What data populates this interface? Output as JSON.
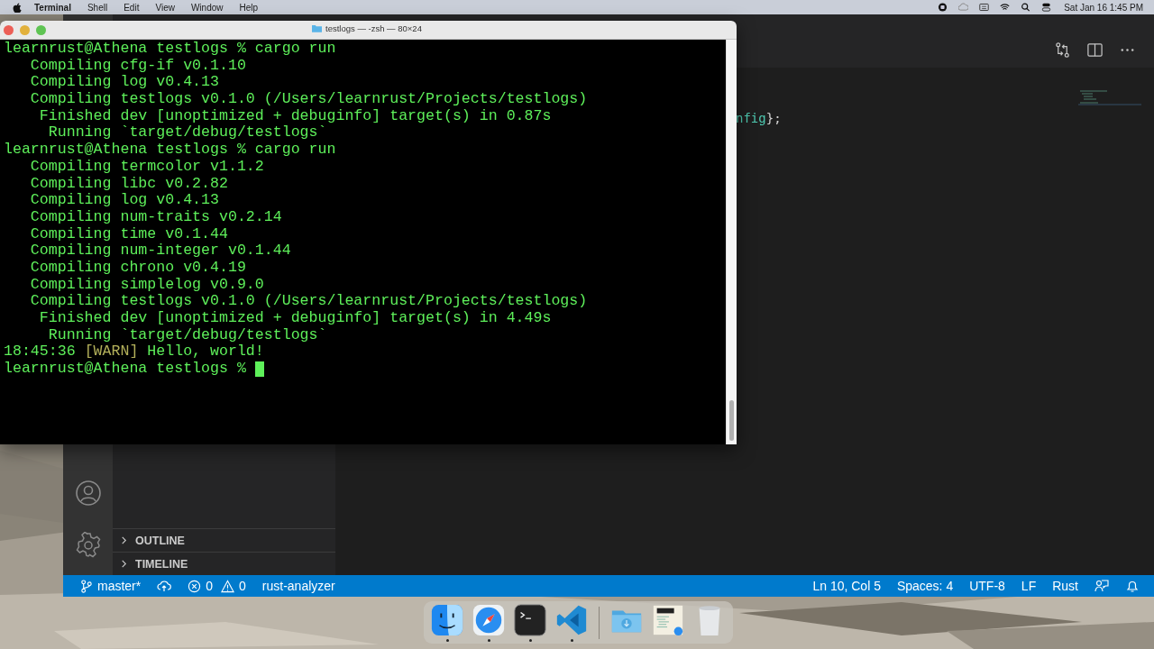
{
  "menubar": {
    "app": "Terminal",
    "menus": [
      "Shell",
      "Edit",
      "View",
      "Window",
      "Help"
    ],
    "clock": "Sat Jan 16  1:45 PM"
  },
  "vscode": {
    "code_tokens": [
      {
        "text": "nfig",
        "kind": "type"
      },
      {
        "text": "};",
        "kind": "punct"
      }
    ],
    "sidebar_sections": [
      {
        "label": "OUTLINE",
        "expanded": false
      },
      {
        "label": "TIMELINE",
        "expanded": false
      }
    ],
    "status_left": [
      {
        "kind": "branch",
        "text": "master*"
      },
      {
        "kind": "sync"
      },
      {
        "kind": "problems",
        "errors": "0",
        "warnings": "0"
      },
      {
        "kind": "plain",
        "text": "rust-analyzer"
      }
    ],
    "status_right": [
      {
        "kind": "plain",
        "text": "Ln 10, Col 5"
      },
      {
        "kind": "plain",
        "text": "Spaces: 4"
      },
      {
        "kind": "plain",
        "text": "UTF-8"
      },
      {
        "kind": "plain",
        "text": "LF"
      },
      {
        "kind": "plain",
        "text": "Rust"
      },
      {
        "kind": "feedback"
      },
      {
        "kind": "bell"
      }
    ]
  },
  "terminal": {
    "title": "testlogs — -zsh — 80×24",
    "lines": [
      {
        "kind": "command",
        "prompt": "learnrust@Athena testlogs %",
        "command": "cargo run"
      },
      {
        "kind": "cargo",
        "verb": "Compiling",
        "detail": "cfg-if v0.1.10"
      },
      {
        "kind": "cargo",
        "verb": "Compiling",
        "detail": "log v0.4.13"
      },
      {
        "kind": "cargo",
        "verb": "Compiling",
        "detail": "testlogs v0.1.0 (/Users/learnrust/Projects/testlogs)"
      },
      {
        "kind": "cargo",
        "verb": "Finished",
        "detail": "dev [unoptimized + debuginfo] target(s) in 0.87s"
      },
      {
        "kind": "cargo",
        "verb": "Running",
        "detail": "`target/debug/testlogs`"
      },
      {
        "kind": "command",
        "prompt": "learnrust@Athena testlogs %",
        "command": "cargo run"
      },
      {
        "kind": "cargo",
        "verb": "Compiling",
        "detail": "termcolor v1.1.2"
      },
      {
        "kind": "cargo",
        "verb": "Compiling",
        "detail": "libc v0.2.82"
      },
      {
        "kind": "cargo",
        "verb": "Compiling",
        "detail": "log v0.4.13"
      },
      {
        "kind": "cargo",
        "verb": "Compiling",
        "detail": "num-traits v0.2.14"
      },
      {
        "kind": "cargo",
        "verb": "Compiling",
        "detail": "time v0.1.44"
      },
      {
        "kind": "cargo",
        "verb": "Compiling",
        "detail": "num-integer v0.1.44"
      },
      {
        "kind": "cargo",
        "verb": "Compiling",
        "detail": "chrono v0.4.19"
      },
      {
        "kind": "cargo",
        "verb": "Compiling",
        "detail": "simplelog v0.9.0"
      },
      {
        "kind": "cargo",
        "verb": "Compiling",
        "detail": "testlogs v0.1.0 (/Users/learnrust/Projects/testlogs)"
      },
      {
        "kind": "cargo",
        "verb": "Finished",
        "detail": "dev [unoptimized + debuginfo] target(s) in 4.49s"
      },
      {
        "kind": "cargo",
        "verb": "Running",
        "detail": "`target/debug/testlogs`"
      },
      {
        "kind": "log",
        "time": "18:45:36",
        "level": "[WARN]",
        "message": "Hello, world!"
      },
      {
        "kind": "prompt",
        "prompt": "learnrust@Athena testlogs %",
        "cursor": true
      }
    ]
  },
  "dock": [
    {
      "kind": "finder",
      "running": true
    },
    {
      "kind": "safari",
      "running": true
    },
    {
      "kind": "terminal",
      "running": true
    },
    {
      "kind": "vscode",
      "running": true
    },
    {
      "kind": "separator"
    },
    {
      "kind": "downloads",
      "running": false
    },
    {
      "kind": "document",
      "running": false
    },
    {
      "kind": "trash",
      "running": false
    }
  ]
}
